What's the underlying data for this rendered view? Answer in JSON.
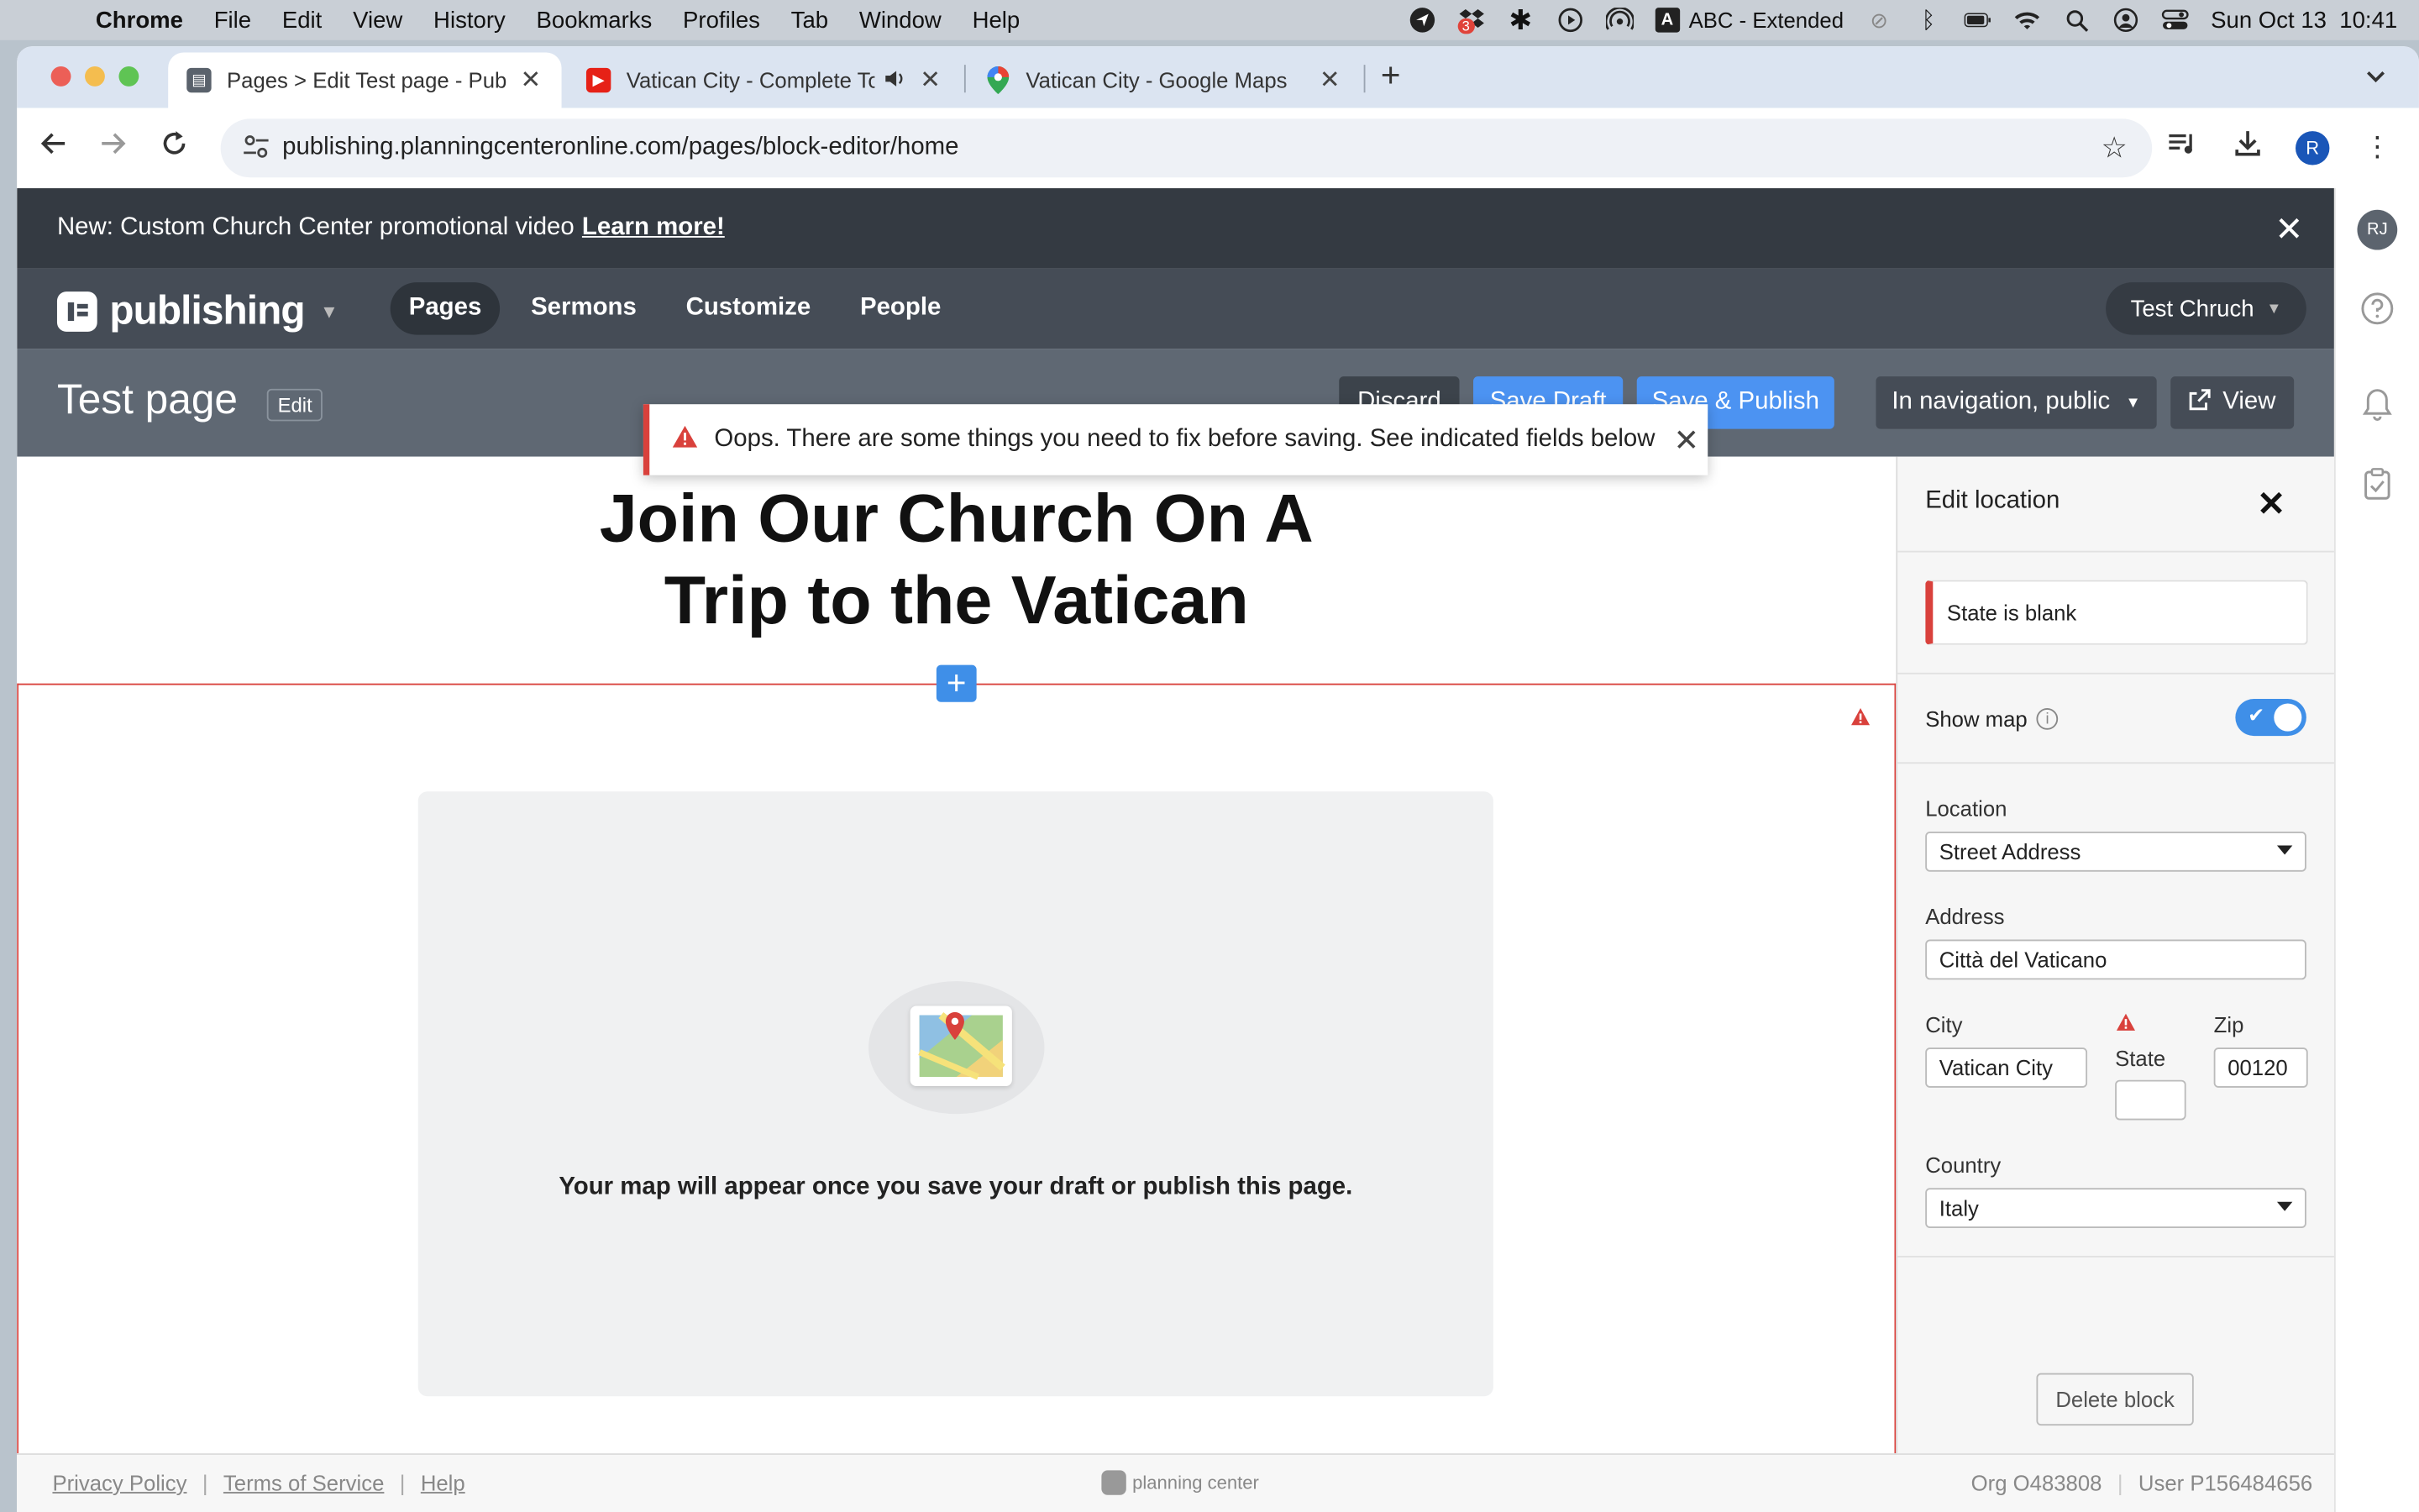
{
  "menubar": {
    "app": "Chrome",
    "items": [
      "File",
      "Edit",
      "View",
      "History",
      "Bookmarks",
      "Profiles",
      "Tab",
      "Window",
      "Help"
    ],
    "input_source": "ABC - Extended",
    "input_badge": "A",
    "notification_count": "3",
    "datetime": "Sun Oct 13  10:41"
  },
  "browser": {
    "tabs": [
      {
        "title": "Pages > Edit Test page - Publishing",
        "active": true
      },
      {
        "title": "Vatican City - Complete Tour",
        "active": false,
        "audio": true
      },
      {
        "title": "Vatican City - Google Maps",
        "active": false
      }
    ],
    "url": "publishing.planningcenteronline.com/pages/block-editor/home",
    "profile_initial": "R"
  },
  "announcement": {
    "text": "New: Custom Church Center promotional video",
    "link": "Learn more!"
  },
  "app": {
    "product": "publishing",
    "nav": [
      "Pages",
      "Sermons",
      "Customize",
      "People"
    ],
    "active_nav": "Pages",
    "org": "Test Chruch"
  },
  "pagehead": {
    "title": "Test page",
    "edit": "Edit",
    "discard": "Discard",
    "save_draft": "Save Draft",
    "save_publish": "Save & Publish",
    "visibility": "In navigation, public",
    "view": "View"
  },
  "toast": {
    "message": "Oops. There are some things you need to fix before saving. See indicated fields below"
  },
  "content": {
    "heading_line1": "Join Our Church On A",
    "heading_line2": "Trip to the Vatican",
    "map_placeholder": "Your map will appear once you save your draft or publish this page."
  },
  "panel": {
    "title": "Edit location",
    "error": "State is blank",
    "show_map_label": "Show map",
    "show_map_on": true,
    "location_label": "Location",
    "location_value": "Street Address",
    "address_label": "Address",
    "address_value": "Città del Vaticano",
    "city_label": "City",
    "city_value": "Vatican City",
    "state_label": "State",
    "state_value": "",
    "zip_label": "Zip",
    "zip_value": "00120",
    "country_label": "Country",
    "country_value": "Italy",
    "delete": "Delete block"
  },
  "footer": {
    "privacy": "Privacy Policy",
    "terms": "Terms of Service",
    "help": "Help",
    "brand": "planning center",
    "org_id": "Org O483808",
    "user_id": "User P156484656"
  },
  "rail": {
    "initials": "RJ"
  },
  "colors": {
    "accent": "#4c93f2",
    "error": "#d9413c",
    "header_dark": "#343a42",
    "nav_bg": "#454c56",
    "pagehead_bg": "#5f6873"
  }
}
